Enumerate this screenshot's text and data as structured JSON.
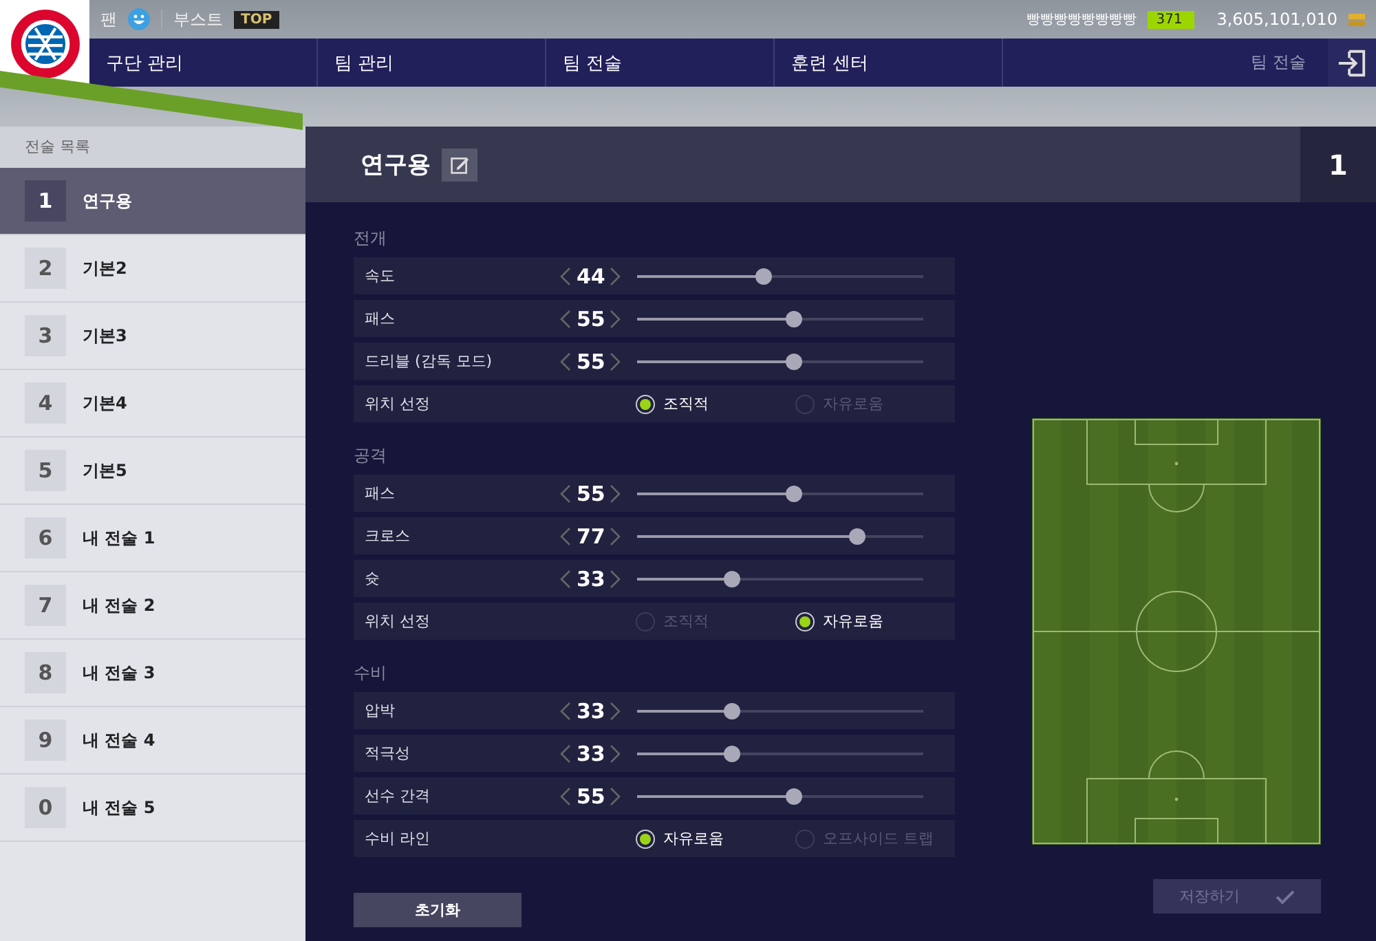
{
  "top_bar": {
    "fan_label": "팬",
    "boost_label": "부스트",
    "boost_badge": "TOP",
    "player_name": "빵빵빵빵빵빵빵빵",
    "level_badge": "371",
    "coins": "3,605,101,010"
  },
  "nav": {
    "items": [
      {
        "label": "구단 관리"
      },
      {
        "label": "팀 관리"
      },
      {
        "label": "팀 전술"
      },
      {
        "label": "훈련 센터"
      }
    ],
    "current_page": "팀 전술"
  },
  "sidebar": {
    "title": "전술 목록",
    "items": [
      {
        "number": "1",
        "name": "연구용",
        "selected": true
      },
      {
        "number": "2",
        "name": "기본2",
        "selected": false
      },
      {
        "number": "3",
        "name": "기본3",
        "selected": false
      },
      {
        "number": "4",
        "name": "기본4",
        "selected": false
      },
      {
        "number": "5",
        "name": "기본5",
        "selected": false
      },
      {
        "number": "6",
        "name": "내 전술 1",
        "selected": false
      },
      {
        "number": "7",
        "name": "내 전술 2",
        "selected": false
      },
      {
        "number": "8",
        "name": "내 전술 3",
        "selected": false
      },
      {
        "number": "9",
        "name": "내 전술 4",
        "selected": false
      },
      {
        "number": "0",
        "name": "내 전술 5",
        "selected": false
      }
    ]
  },
  "panel": {
    "title": "연구용",
    "slot_number": "1",
    "sections": [
      {
        "title": "전개",
        "rows": [
          {
            "kind": "slider",
            "label": "속도",
            "value": "44",
            "level": 0.44
          },
          {
            "kind": "slider",
            "label": "패스",
            "value": "55",
            "level": 0.55
          },
          {
            "kind": "slider",
            "label": "드리블 (감독 모드)",
            "value": "55",
            "level": 0.55
          },
          {
            "kind": "radio",
            "label": "위치 선정",
            "options": [
              {
                "label": "조직적",
                "selected": true
              },
              {
                "label": "자유로움",
                "selected": false
              }
            ]
          }
        ]
      },
      {
        "title": "공격",
        "rows": [
          {
            "kind": "slider",
            "label": "패스",
            "value": "55",
            "level": 0.55
          },
          {
            "kind": "slider",
            "label": "크로스",
            "value": "77",
            "level": 0.77
          },
          {
            "kind": "slider",
            "label": "슛",
            "value": "33",
            "level": 0.33
          },
          {
            "kind": "radio",
            "label": "위치 선정",
            "options": [
              {
                "label": "조직적",
                "selected": false
              },
              {
                "label": "자유로움",
                "selected": true
              }
            ]
          }
        ]
      },
      {
        "title": "수비",
        "rows": [
          {
            "kind": "slider",
            "label": "압박",
            "value": "33",
            "level": 0.33
          },
          {
            "kind": "slider",
            "label": "적극성",
            "value": "33",
            "level": 0.33
          },
          {
            "kind": "slider",
            "label": "선수 간격",
            "value": "55",
            "level": 0.55
          },
          {
            "kind": "radio",
            "label": "수비 라인",
            "options": [
              {
                "label": "자유로움",
                "selected": true
              },
              {
                "label": "오프사이드 트랩",
                "selected": false
              }
            ]
          }
        ]
      }
    ],
    "reset_button": "초기화",
    "save_button": {
      "label": "저장하기",
      "disabled": true
    }
  }
}
